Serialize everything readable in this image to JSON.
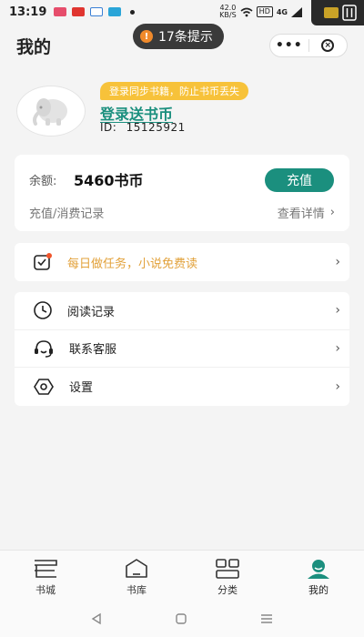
{
  "status_bar": {
    "time": "13:19",
    "net_speed": "42.0",
    "net_unit": "KB/S",
    "hd": "HD",
    "signal": "4G"
  },
  "header": {
    "title": "我的",
    "toast": "17条提示",
    "more_icon": "more-dots-icon",
    "close_icon": "close-circle-icon"
  },
  "profile": {
    "promo": "登录同步书籍，防止书币丢失",
    "login_text": "登录送书币",
    "id_label": "ID:",
    "id_value": "15125921"
  },
  "balance": {
    "label": "余额:",
    "value": "5460书币",
    "recharge": "充值",
    "records": "充值/消费记录",
    "details": "查看详情"
  },
  "task": {
    "label": "每日做任务，小说免费读"
  },
  "menu": [
    {
      "label": "阅读记录",
      "icon": "clock-icon"
    },
    {
      "label": "联系客服",
      "icon": "headset-icon"
    },
    {
      "label": "设置",
      "icon": "settings-hex-icon"
    }
  ],
  "tabs": [
    {
      "label": "书城",
      "icon": "bookshelf-icon",
      "active": false
    },
    {
      "label": "书库",
      "icon": "library-icon",
      "active": false
    },
    {
      "label": "分类",
      "icon": "category-grid-icon",
      "active": false
    },
    {
      "label": "我的",
      "icon": "person-icon",
      "active": true
    }
  ],
  "colors": {
    "accent": "#1b8f7e",
    "promo": "#f7c23a",
    "task_text": "#e2a13a",
    "toast_bg": "#3a3a3a"
  }
}
